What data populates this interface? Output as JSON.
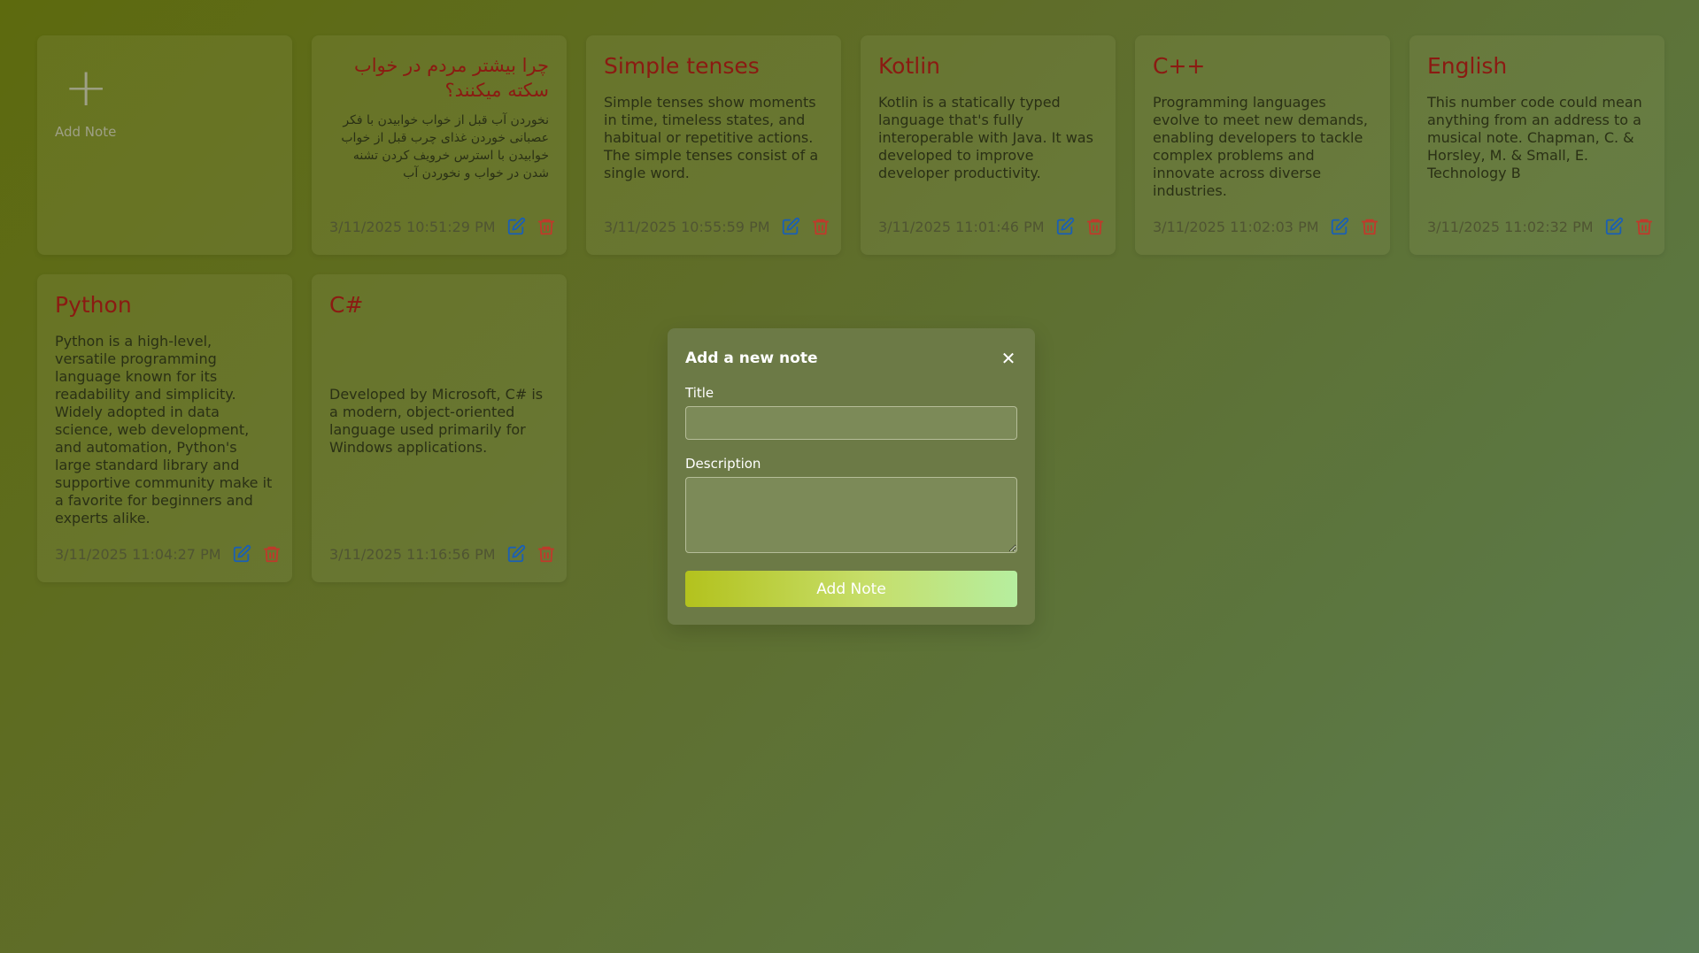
{
  "add_card": {
    "plus": "+",
    "label": "Add Note"
  },
  "notes": [
    {
      "title": "چرا بیشتر مردم در خواب سکته میکنند؟",
      "description": "نخوردن آب قبل از خواب خوابیدن با فکر عصبانی خوردن غذای چرب قبل از خواب خوابیدن با استرس خرویف کردن تشنه شدن در خواب و نخوردن آب",
      "date": "3/11/2025 10:51:29 PM"
    },
    {
      "title": "Simple tenses",
      "description": "Simple tenses show moments in time, timeless states, and habitual or repetitive actions. The simple tenses consist of a single word.",
      "date": "3/11/2025 10:55:59 PM"
    },
    {
      "title": "Kotlin",
      "description": "Kotlin is a statically typed language that's fully interoperable with Java. It was developed to improve developer productivity.",
      "date": "3/11/2025 11:01:46 PM"
    },
    {
      "title": "C++",
      "description": "Programming languages evolve to meet new demands, enabling developers to tackle complex problems and innovate across diverse industries.",
      "date": "3/11/2025 11:02:03 PM"
    },
    {
      "title": "English",
      "description": "This number code could mean anything from an address to a musical note. Chapman, C. & Horsley, M. & Small, E. Technology B",
      "date": "3/11/2025 11:02:32 PM"
    },
    {
      "title": "Python",
      "description": "Python is a high-level, versatile programming language known for its readability and simplicity. Widely adopted in data science, web development, and automation, Python's large standard library and supportive community make it a favorite for beginners and experts alike.",
      "date": "3/11/2025 11:04:27 PM"
    },
    {
      "title": "C#",
      "description": "Developed by Microsoft, C# is a modern, object-oriented language used primarily for Windows applications.",
      "date": "3/11/2025 11:16:56 PM"
    }
  ],
  "modal": {
    "title": "Add a new note",
    "close": "✕",
    "title_label": "Title",
    "title_value": "",
    "description_label": "Description",
    "description_value": "",
    "submit_label": "Add Note"
  },
  "colors": {
    "edit_icon": "#1a5fb4",
    "delete_icon": "#c0392b",
    "note_title": "#8b1a12"
  }
}
